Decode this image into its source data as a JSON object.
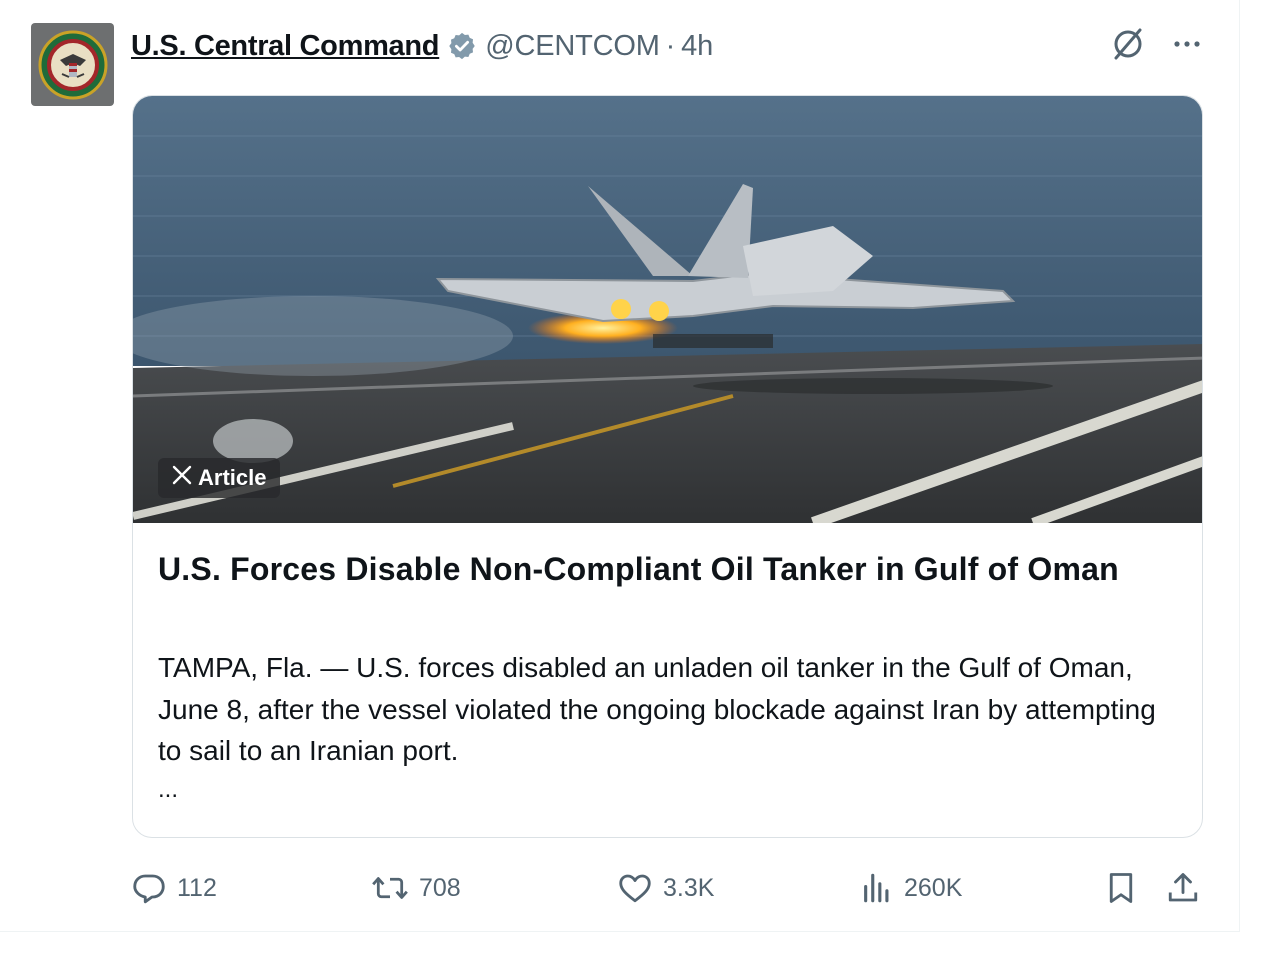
{
  "post": {
    "display_name": "U.S. Central Command",
    "handle": "@CENTCOM",
    "separator": "·",
    "time": "4h"
  },
  "article": {
    "badge_label": "Article",
    "title": "U.S. Forces Disable Non-Compliant Oil Tanker in Gulf of Oman",
    "body": "TAMPA, Fla. — U.S. forces disabled an unladen oil tanker in the Gulf of Oman, June 8, after the vessel violated the ongoing blockade against Iran by attempting to sail to an Iranian port.",
    "ellipsis": "..."
  },
  "actions": {
    "replies": "112",
    "reposts": "708",
    "likes": "3.3K",
    "views": "260K"
  },
  "icons": {
    "verified": "verified-badge-icon",
    "grok": "grok-icon",
    "more": "more-icon",
    "reply": "reply-icon",
    "repost": "repost-icon",
    "like": "heart-icon",
    "views": "views-icon",
    "bookmark": "bookmark-icon",
    "share": "share-icon"
  },
  "colors": {
    "text": "#0f1419",
    "secondary": "#536471",
    "verified": "#829aab"
  }
}
